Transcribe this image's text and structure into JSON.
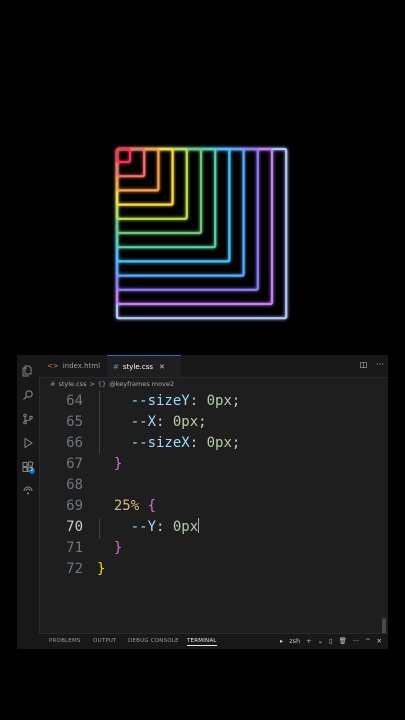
{
  "artwork": {
    "description_colors": [
      "#ff2d55",
      "#ff6b6b",
      "#ff9f43",
      "#ffd93d",
      "#b8e04a",
      "#6bcb77",
      "#4dd4ac",
      "#40c4ff",
      "#5aa9ff",
      "#8c7bff",
      "#c77dff",
      "#b0c8ff"
    ]
  },
  "activity_bar": {
    "icons": [
      "files-icon",
      "search-icon",
      "source-control-icon",
      "run-debug-icon",
      "extensions-icon",
      "remote-icon"
    ],
    "extensions_badge": "2"
  },
  "tabs": [
    {
      "label": "index.html",
      "icon": "<>",
      "active": false
    },
    {
      "label": "style.css",
      "icon": "#",
      "active": true,
      "close": "✕"
    }
  ],
  "breadcrumb": {
    "file_icon": "#",
    "file": "style.css",
    "separator": ">",
    "symbol_icon": "{}",
    "symbol": "@keyframes move2"
  },
  "code": {
    "lines": [
      {
        "n": "64",
        "indent": "    ",
        "prop": "--sizeY",
        "colon": ": ",
        "value": "0px",
        "end": ";"
      },
      {
        "n": "65",
        "indent": "    ",
        "prop": "--X",
        "colon": ": ",
        "value": "0px",
        "end": ";"
      },
      {
        "n": "66",
        "indent": "    ",
        "prop": "--sizeX",
        "colon": ": ",
        "value": "0px",
        "end": ";"
      },
      {
        "n": "67",
        "indent": "  ",
        "brace": "}"
      },
      {
        "n": "68"
      },
      {
        "n": "69",
        "indent": "  ",
        "selector": "25%",
        "brace": "{"
      },
      {
        "n": "70",
        "indent": "    ",
        "prop": "--Y",
        "colon": ": ",
        "value": "0px",
        "current": true
      },
      {
        "n": "71",
        "indent": "  ",
        "brace": "}"
      },
      {
        "n": "72",
        "brace": "}"
      }
    ]
  },
  "panel": {
    "tabs": [
      "PROBLEMS",
      "OUTPUT",
      "DEBUG CONSOLE",
      "TERMINAL"
    ],
    "active_tab": "TERMINAL",
    "shell": "zsh",
    "actions": [
      "+",
      "⌄",
      "▯",
      "🗑",
      "···",
      "^",
      "✕"
    ]
  }
}
